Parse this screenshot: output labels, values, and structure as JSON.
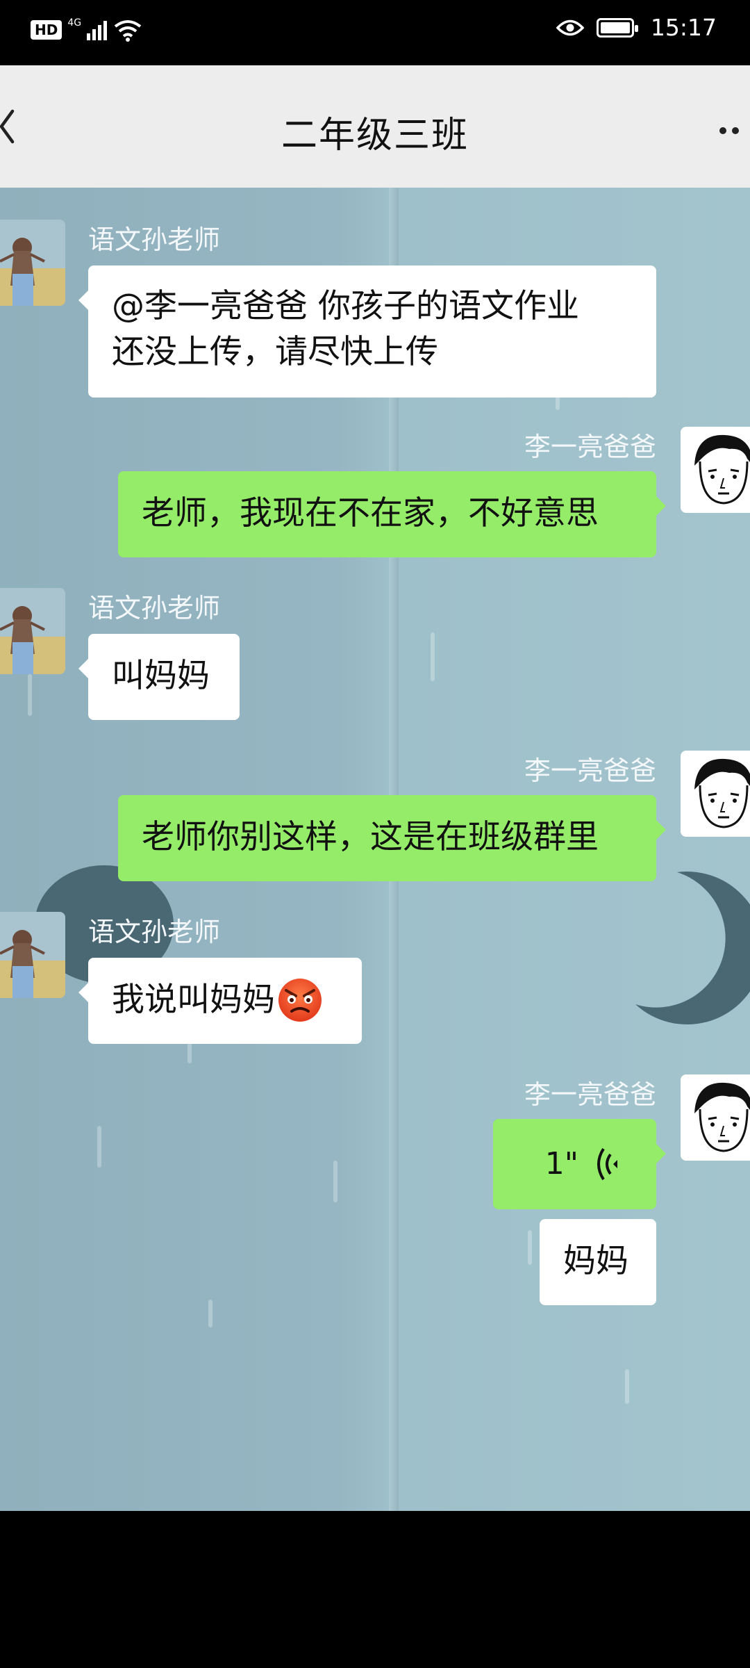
{
  "status_bar": {
    "hd": "HD",
    "network": "4G",
    "time": "15:17"
  },
  "header": {
    "title": "二年级三班"
  },
  "messages": [
    {
      "sender": "语文孙老师",
      "side": "left",
      "text_lines": [
        "@李一亮爸爸 你孩子的语文作业",
        "还没上传，请尽快上传"
      ]
    },
    {
      "sender": "李一亮爸爸",
      "side": "right",
      "text": "老师，我现在不在家，不好意思"
    },
    {
      "sender": "语文孙老师",
      "side": "left",
      "text": "叫妈妈"
    },
    {
      "sender": "李一亮爸爸",
      "side": "right",
      "text": "老师你别这样，这是在班级群里"
    },
    {
      "sender": "语文孙老师",
      "side": "left",
      "text": "我说叫妈妈",
      "emoji": "angry-face-icon"
    },
    {
      "sender": "李一亮爸爸",
      "side": "right",
      "voice_duration": "1\"",
      "transcript": "妈妈"
    }
  ],
  "colors": {
    "outgoing_bubble": "#95ec69",
    "incoming_bubble": "#ffffff",
    "header_bg": "#ededed"
  }
}
